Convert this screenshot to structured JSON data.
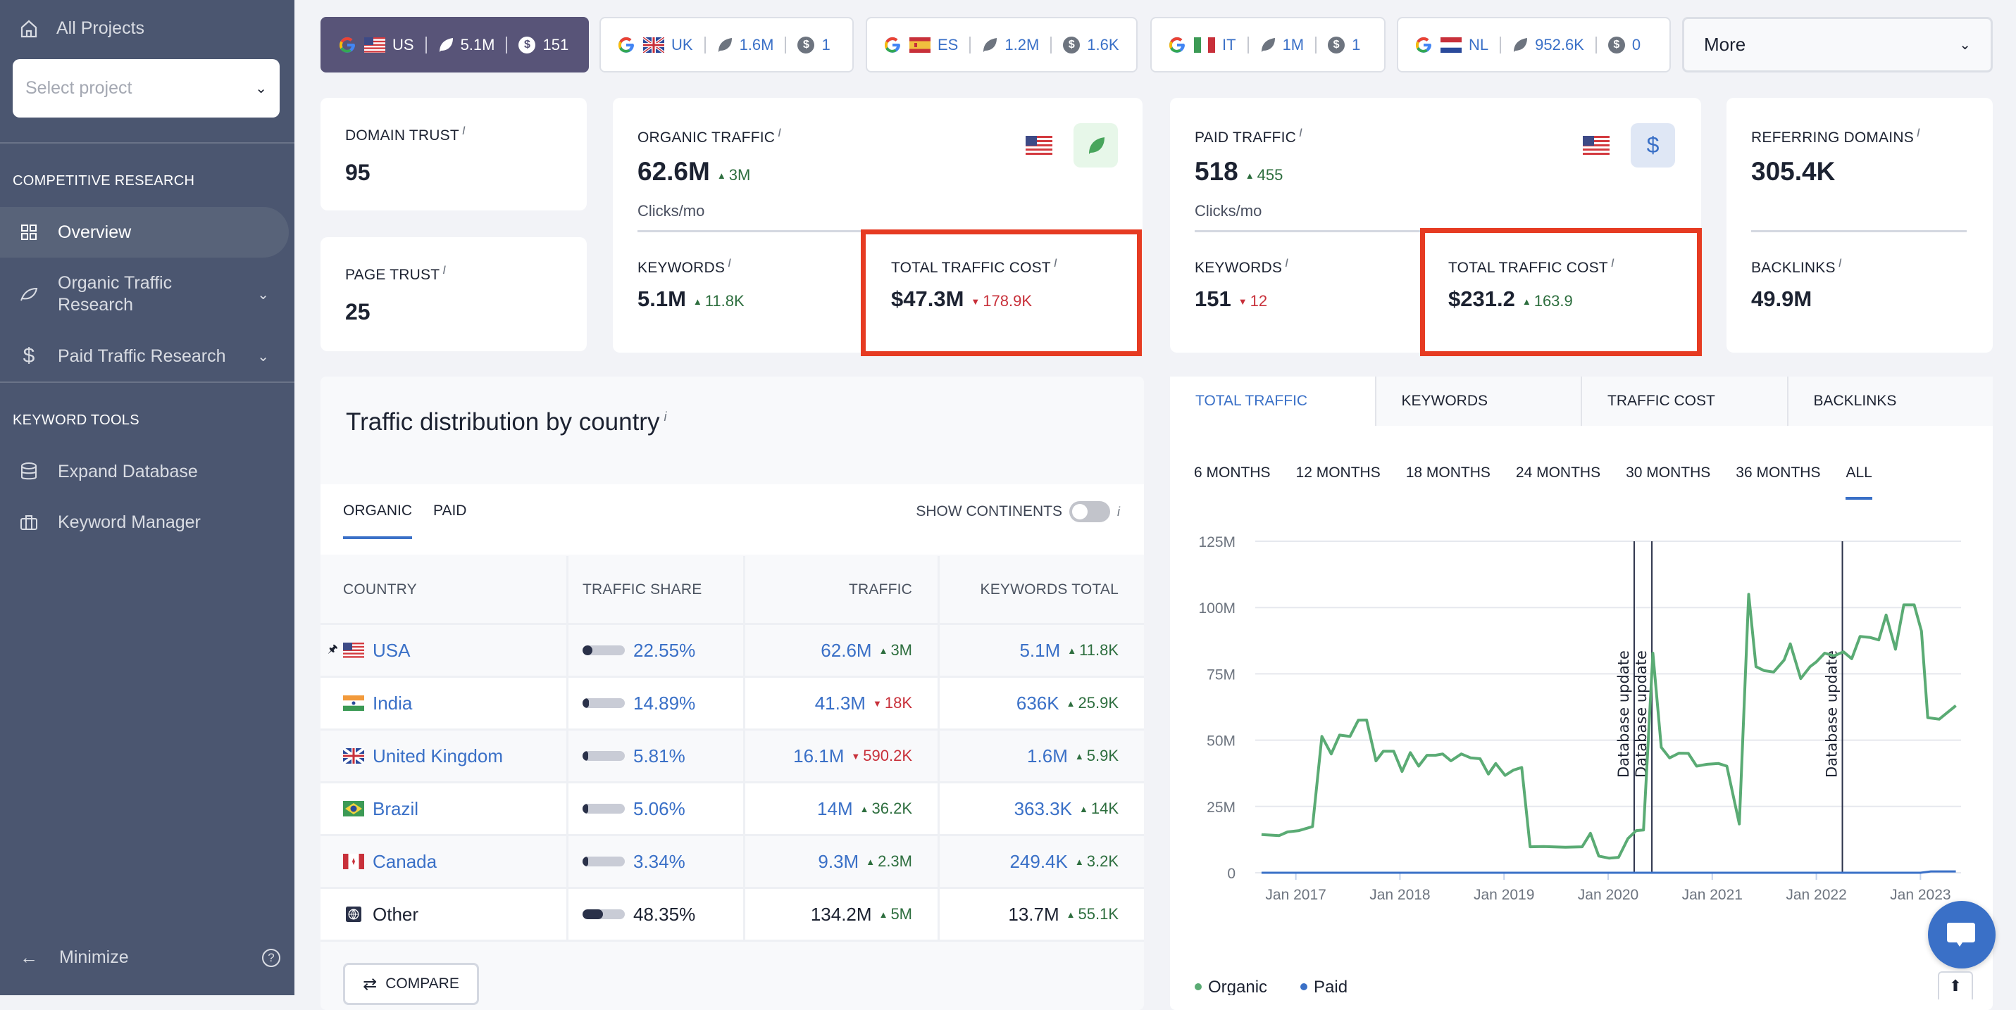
{
  "sidebar": {
    "all_projects": "All Projects",
    "select_placeholder": "Select project",
    "sections": [
      {
        "title": "COMPETITIVE RESEARCH"
      },
      {
        "title": "KEYWORD TOOLS"
      }
    ],
    "items": [
      {
        "label": "Overview",
        "icon": "grid-icon",
        "active": true
      },
      {
        "label": "Organic Traffic Research",
        "icon": "leaf-icon"
      },
      {
        "label": "Paid Traffic Research",
        "icon": "dollar-icon"
      },
      {
        "label": "Expand Database",
        "icon": "database-icon"
      },
      {
        "label": "Keyword Manager",
        "icon": "briefcase-icon"
      }
    ],
    "minimize": "Minimize"
  },
  "databases": [
    {
      "code": "US",
      "organic": "5.1M",
      "paid": "151",
      "active": true
    },
    {
      "code": "UK",
      "organic": "1.6M",
      "paid": "1"
    },
    {
      "code": "ES",
      "organic": "1.2M",
      "paid": "1.6K"
    },
    {
      "code": "IT",
      "organic": "1M",
      "paid": "1"
    },
    {
      "code": "NL",
      "organic": "952.6K",
      "paid": "0"
    }
  ],
  "more_label": "More",
  "metrics": {
    "domain_trust": {
      "label": "DOMAIN TRUST",
      "value": "95"
    },
    "page_trust": {
      "label": "PAGE TRUST",
      "value": "25"
    },
    "organic": {
      "label": "ORGANIC TRAFFIC",
      "value": "62.6M",
      "delta": "3M",
      "unit": "Clicks/mo",
      "keywords_label": "KEYWORDS",
      "keywords": "5.1M",
      "keywords_delta": "11.8K",
      "cost_label": "TOTAL TRAFFIC COST",
      "cost": "$47.3M",
      "cost_delta": "178.9K"
    },
    "paid": {
      "label": "PAID TRAFFIC",
      "value": "518",
      "delta": "455",
      "unit": "Clicks/mo",
      "keywords_label": "KEYWORDS",
      "keywords": "151",
      "keywords_delta": "12",
      "cost_label": "TOTAL TRAFFIC COST",
      "cost": "$231.2",
      "cost_delta": "163.9"
    },
    "referring": {
      "label": "REFERRING DOMAINS",
      "value": "305.4K",
      "backlinks_label": "BACKLINKS",
      "backlinks": "49.9M"
    }
  },
  "distribution": {
    "title": "Traffic distribution by country",
    "tabs": [
      "ORGANIC",
      "PAID"
    ],
    "show_continents": "SHOW CONTINENTS",
    "columns": [
      "COUNTRY",
      "TRAFFIC SHARE",
      "TRAFFIC",
      "KEYWORDS TOTAL"
    ],
    "rows": [
      {
        "country": "USA",
        "flag": "us",
        "pinned": true,
        "share": "22.55%",
        "share_value": 22.55,
        "traffic": "62.6M",
        "traffic_delta": "3M",
        "traffic_dir": "up",
        "keywords": "5.1M",
        "keywords_delta": "11.8K",
        "keywords_dir": "up"
      },
      {
        "country": "India",
        "flag": "in",
        "share": "14.89%",
        "share_value": 14.89,
        "traffic": "41.3M",
        "traffic_delta": "18K",
        "traffic_dir": "down",
        "keywords": "636K",
        "keywords_delta": "25.9K",
        "keywords_dir": "up"
      },
      {
        "country": "United Kingdom",
        "flag": "uk",
        "share": "5.81%",
        "share_value": 5.81,
        "traffic": "16.1M",
        "traffic_delta": "590.2K",
        "traffic_dir": "down",
        "keywords": "1.6M",
        "keywords_delta": "5.9K",
        "keywords_dir": "up"
      },
      {
        "country": "Brazil",
        "flag": "br",
        "share": "5.06%",
        "share_value": 5.06,
        "traffic": "14M",
        "traffic_delta": "36.2K",
        "traffic_dir": "up",
        "keywords": "363.3K",
        "keywords_delta": "14K",
        "keywords_dir": "up"
      },
      {
        "country": "Canada",
        "flag": "ca",
        "share": "3.34%",
        "share_value": 3.34,
        "traffic": "9.3M",
        "traffic_delta": "2.3M",
        "traffic_dir": "up",
        "keywords": "249.4K",
        "keywords_delta": "3.2K",
        "keywords_dir": "up"
      },
      {
        "country": "Other",
        "flag": "globe",
        "share": "48.35%",
        "share_value": 48.35,
        "traffic": "134.2M",
        "traffic_delta": "5M",
        "traffic_dir": "up",
        "keywords": "13.7M",
        "keywords_delta": "55.1K",
        "keywords_dir": "up"
      }
    ],
    "compare": "COMPARE"
  },
  "chart_tabs": [
    "TOTAL TRAFFIC",
    "KEYWORDS",
    "TRAFFIC COST",
    "BACKLINKS"
  ],
  "ranges": [
    "6 MONTHS",
    "12 MONTHS",
    "18 MONTHS",
    "24 MONTHS",
    "30 MONTHS",
    "36 MONTHS",
    "ALL"
  ],
  "colors": {
    "organic": "#5aab74",
    "paid": "#3a70c7",
    "accent": "#3a70c7",
    "highlight": "#e63b22"
  },
  "chart_data": {
    "type": "line",
    "title": "Total Traffic",
    "xlabel": "",
    "ylabel": "",
    "xlim": [
      2016.61,
      2023.39
    ],
    "ylim": [
      0,
      125000000
    ],
    "yticks": [
      0,
      25000000,
      50000000,
      75000000,
      100000000,
      125000000
    ],
    "ytick_labels": [
      "0",
      "25M",
      "50M",
      "75M",
      "100M",
      "125M"
    ],
    "xticks": [
      2017,
      2018,
      2019,
      2020,
      2021,
      2022,
      2023
    ],
    "xtick_labels": [
      "Jan 2017",
      "Jan 2018",
      "Jan 2019",
      "Jan 2020",
      "Jan 2021",
      "Jan 2022",
      "Jan 2023"
    ],
    "grid": true,
    "legend": "bottom-left",
    "annotations": [
      {
        "x": 2020.25,
        "text": "Database update"
      },
      {
        "x": 2020.42,
        "text": "Database update"
      },
      {
        "x": 2022.25,
        "text": "Database update"
      }
    ],
    "series": [
      {
        "name": "Organic",
        "x": [
          2016.67,
          2016.84,
          2016.92,
          2017.03,
          2017.16,
          2017.25,
          2017.34,
          2017.42,
          2017.52,
          2017.6,
          2017.68,
          2017.77,
          2017.84,
          2017.94,
          2018.02,
          2018.1,
          2018.18,
          2018.26,
          2018.34,
          2018.41,
          2018.49,
          2018.59,
          2018.68,
          2018.77,
          2018.85,
          2018.92,
          2019.01,
          2019.09,
          2019.17,
          2019.25,
          2019.38,
          2019.59,
          2019.75,
          2019.83,
          2019.91,
          2020.01,
          2020.1,
          2020.19,
          2020.27,
          2020.34,
          2020.43,
          2020.51,
          2020.59,
          2020.68,
          2020.77,
          2020.85,
          2020.95,
          2021.06,
          2021.14,
          2021.26,
          2021.35,
          2021.42,
          2021.5,
          2021.59,
          2021.69,
          2021.75,
          2021.85,
          2021.94,
          2022.0,
          2022.08,
          2022.17,
          2022.26,
          2022.34,
          2022.42,
          2022.52,
          2022.6,
          2022.67,
          2022.76,
          2022.84,
          2022.94,
          2023.01,
          2023.07,
          2023.18,
          2023.34
        ],
        "values": [
          14.4,
          14.0,
          15.4,
          15.9,
          17.4,
          51.4,
          44.8,
          51.9,
          51.4,
          57.5,
          57.6,
          42.2,
          45.8,
          45.8,
          38.2,
          45.3,
          40.2,
          44.3,
          44.3,
          44.8,
          42.2,
          44.8,
          43.3,
          43.0,
          37.2,
          41.2,
          36.7,
          38.7,
          39.7,
          9.8,
          9.9,
          9.6,
          9.8,
          14.9,
          6.3,
          5.5,
          5.8,
          12.9,
          15.9,
          16.1,
          82.8,
          47.3,
          43.3,
          45.1,
          45.0,
          40.2,
          40.9,
          41.2,
          40.2,
          18.4,
          105.0,
          77.7,
          76.2,
          75.7,
          80.2,
          86.3,
          73.2,
          77.7,
          79.5,
          82.8,
          81.8,
          83.3,
          80.7,
          89.1,
          88.7,
          87.8,
          97.2,
          84.3,
          101.0,
          101.0,
          91.1,
          58.5,
          57.9,
          63.0
        ],
        "unit": "M"
      },
      {
        "name": "Paid",
        "x": [
          2016.67,
          2023.0,
          2023.1,
          2023.34
        ],
        "values": [
          0,
          0,
          0.5,
          0.5
        ],
        "unit": "M"
      }
    ]
  }
}
